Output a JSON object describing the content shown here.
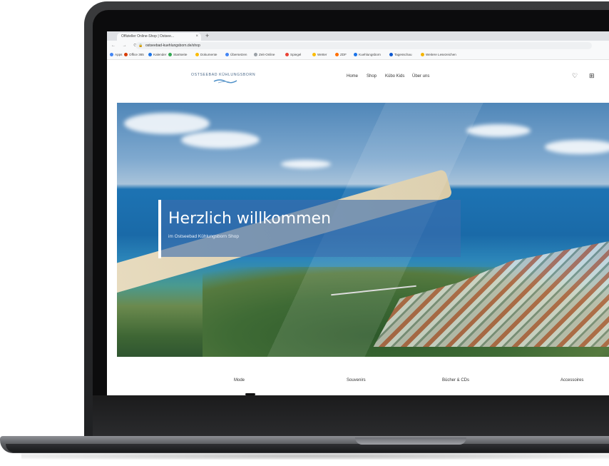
{
  "browser": {
    "tab_title": "Offizieller Online-Shop | Ostsee...",
    "tab_close": "×",
    "new_tab": "+",
    "nav_buttons": "← → ⟳",
    "url": "ostseebad-kuehlungsborn.de/shop",
    "bookmarks": [
      "Apps",
      "Office 365",
      "Kalender",
      "Startseite",
      "Dokumente",
      "Übersetzen",
      "Zeit-Online",
      "Spiegel",
      "Wetter",
      "ZDF",
      "Kuehlungsborn",
      "Tagesschau",
      "Weitere Lesezeichen"
    ],
    "bookmark_colors": [
      "#4285f4",
      "#d83b01",
      "#1a73e8",
      "#34a853",
      "#fbbc05",
      "#4285f4",
      "#9aa0a6",
      "#ea4335",
      "#fbbc05",
      "#ff6f00",
      "#1a73e8",
      "#0b57d0",
      "#f4b400"
    ]
  },
  "header": {
    "logo_text": "OSTSEEBAD KÜHLUNGSBORN",
    "nav": [
      "Home",
      "Shop",
      "Kübo Kids",
      "Über uns"
    ],
    "wishlist_icon": "♡",
    "cart_icon": "⊞"
  },
  "hero": {
    "title": "Herzlich willkommen",
    "subtitle": "im Ostseebad Kühlungsborn Shop"
  },
  "categories": [
    "Mode",
    "Souvenirs",
    "Bücher & CDs",
    "Accessoires"
  ],
  "colors": {
    "accent": "#3c6eaf",
    "logo": "#4c6a8a"
  }
}
